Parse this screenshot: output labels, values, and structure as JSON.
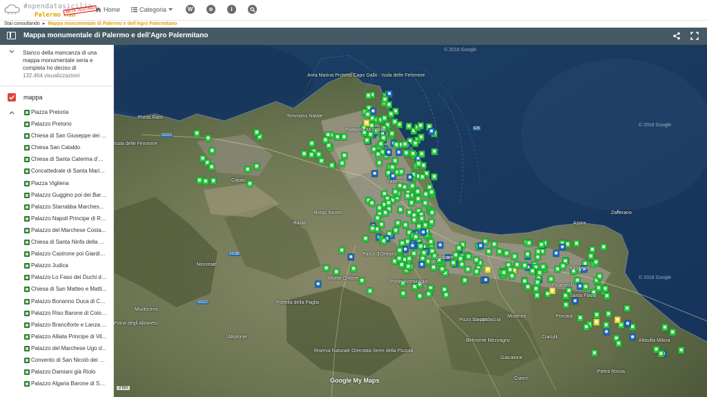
{
  "header": {
    "logo_text": "#opendatasicilia",
    "logo_sub": "Palermo Hub",
    "logo_badge": "BETA TESTING",
    "nav_home": "Home",
    "nav_categoria": "Categoria",
    "nav_icons": [
      "wordpress-icon",
      "github-icon",
      "info-icon",
      "search-icon"
    ]
  },
  "breadcrumb": {
    "prefix": "Stai consultando",
    "current": "Mappa monumentale di Palermo e dell'Agro Palermitano"
  },
  "mapbar": {
    "title": "Mappa monumentale di Palermo e dell'Agro Palermitano"
  },
  "sidebar": {
    "description": "Stanco della mancanza di una mappa monumentale seria e completa ho deciso di",
    "views": "132.464 visualizzazioni",
    "layer_name": "mappa",
    "items": [
      "Piazza Pretoria",
      "Palazzo Pretorio",
      "Chiesa di San Giuseppe dei P...",
      "Chiesa San Cataldo",
      "Chiesa di Santa Caterina d'Al...",
      "Concattedrale di Santa Maria...",
      "Piazza Vigliena",
      "Palazzo Guggino poi dei Baro...",
      "Palazzo Starrabba Marchese ...",
      "Palazzo Napoli Principe di Re...",
      "Palazzo del Marchese Costa...",
      "Chiesa di Santa Ninfa della C...",
      "Palazzo Castrone poi Giardin...",
      "Palazzo Judica",
      "Palazzo Lo Faso dei Duchi di ...",
      "Chiesa di San Matteo e Matti...",
      "Palazzo Bonanno Duca di Ca...",
      "Palazzo Riso Barone di Colob...",
      "Palazzo Branciforte e Lanza ...",
      "Palazzo Alliata Principe di Vil...",
      "Palazzo del Marchese Ugo d...",
      "Convento di San Nicolò dei B...",
      "Palazzo Damiani già Riolo",
      "Palazzo Algaria Barone di Sa..."
    ]
  },
  "map": {
    "area_label": "Area Marina Protetta Capo Gallo - Isola delle Femmine",
    "labels": [
      "Partanna Mondello",
      "Punta Raisi",
      "Capaci",
      "Palermo",
      "Bagheria",
      "Monreale",
      "Misilmeri",
      "Villabate",
      "Ficarazzi",
      "Altavilla Milicia",
      "Porcara",
      "Zafferano",
      "Isola delle Femmine",
      "Piana degli Albanesi",
      "Altofonte",
      "Belmonte Mezzagno",
      "Riserva Naturale Orientata Serre della Pizzuta",
      "Casteldaccia",
      "Parco d'Orleans",
      "Santa Flavia",
      "Tommaso Natale",
      "Borgo Nuovo",
      "Monte Grifone",
      "Portella della Paglia",
      "Giacalone",
      "Pizzo Stoppa",
      "Aspra",
      "Ponte Ammiraglio",
      "Baida",
      "Misiliscemi",
      "Ciaculli",
      "Pietra Rossa",
      "Ciannì"
    ],
    "google_logo": "Google My Maps",
    "scale": "2 km",
    "copyright": "© 2018 Google"
  },
  "colors": {
    "map_bar": "#455a64",
    "accent_orange": "#e8a000",
    "marker_green": "#27c93f",
    "layer_red": "#db4437"
  }
}
